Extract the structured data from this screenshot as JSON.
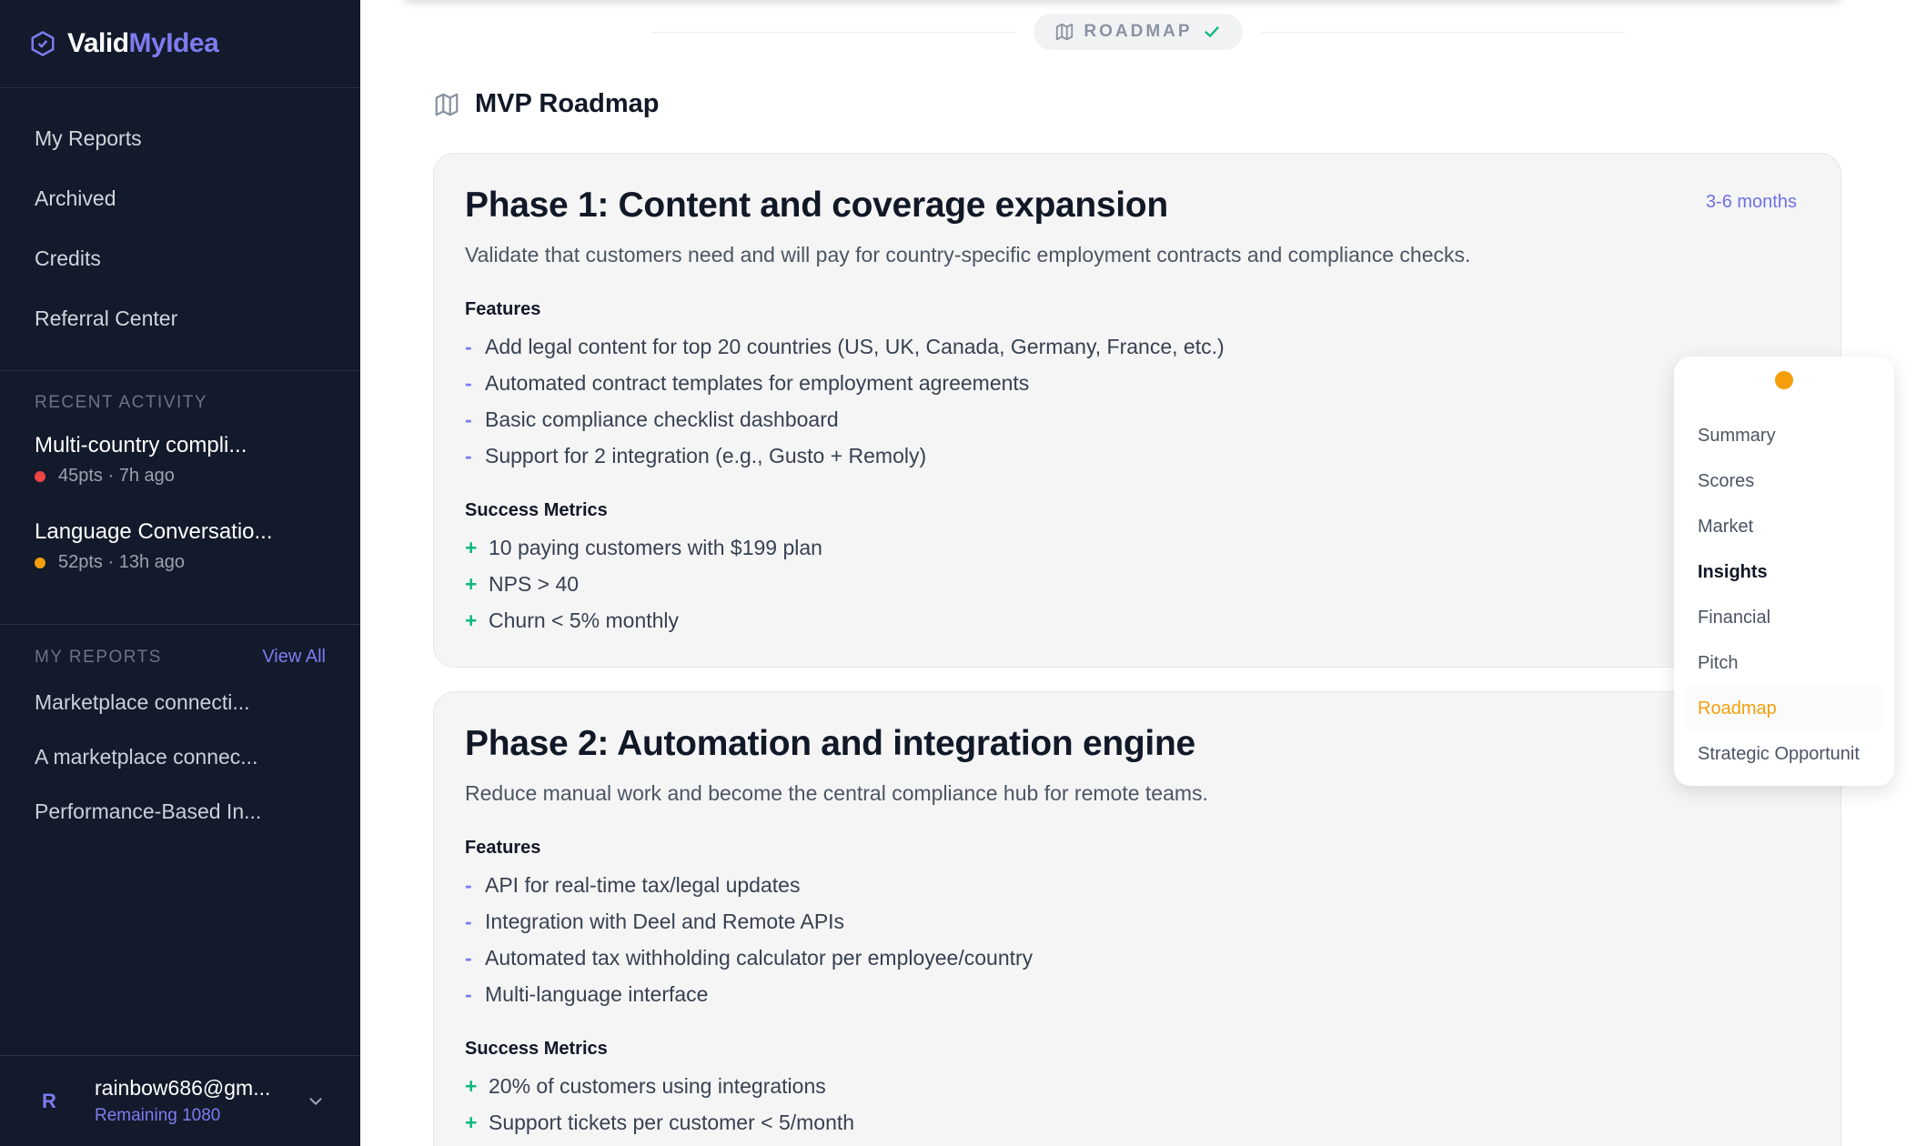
{
  "brand": {
    "part1": "Valid",
    "part2": "MyIdea"
  },
  "nav": [
    "My Reports",
    "Archived",
    "Credits",
    "Referral Center"
  ],
  "recent": {
    "title": "RECENT ACTIVITY",
    "items": [
      {
        "title": "Multi-country compli...",
        "meta": "45pts · 7h ago",
        "color": "#ef4444"
      },
      {
        "title": "Language Conversatio...",
        "meta": "52pts · 13h ago",
        "color": "#f59e0b"
      }
    ]
  },
  "my_reports": {
    "title": "MY REPORTS",
    "view_all": "View All",
    "items": [
      "Marketplace connecti...",
      "A marketplace connec...",
      "Performance-Based In..."
    ]
  },
  "account": {
    "initial": "R",
    "email": "rainbow686@gm...",
    "remaining": "Remaining 1080"
  },
  "section_pill": "ROADMAP",
  "page_title": "MVP Roadmap",
  "phases": [
    {
      "title": "Phase 1: Content and coverage expansion",
      "duration": "3-6 months",
      "description": "Validate that customers need and will pay for country-specific employment contracts and compliance checks.",
      "features_label": "Features",
      "features": [
        "Add legal content for top 20 countries (US, UK, Canada, Germany, France, etc.)",
        "Automated contract templates for employment agreements",
        "Basic compliance checklist dashboard",
        "Support for 2 integration (e.g., Gusto + Remoly)"
      ],
      "metrics_label": "Success Metrics",
      "metrics": [
        "10 paying customers with $199 plan",
        "NPS > 40",
        "Churn < 5% monthly"
      ]
    },
    {
      "title": "Phase 2: Automation and integration engine",
      "description": "Reduce manual work and become the central compliance hub for remote teams.",
      "features_label": "Features",
      "features": [
        "API for real-time tax/legal updates",
        "Integration with Deel and Remote APIs",
        "Automated tax withholding calculator per employee/country",
        "Multi-language interface"
      ],
      "metrics_label": "Success Metrics",
      "metrics": [
        "20% of customers using integrations",
        "Support tickets per customer < 5/month"
      ]
    }
  ],
  "float_nav": [
    "Summary",
    "Scores",
    "Market",
    "Insights",
    "Financial",
    "Pitch",
    "Roadmap",
    "Strategic Opportunit"
  ],
  "colors": {
    "accent": "#7c7cf0",
    "active": "#f59e0b",
    "sidebar_bg": "#121a2b",
    "success": "#10b981"
  }
}
